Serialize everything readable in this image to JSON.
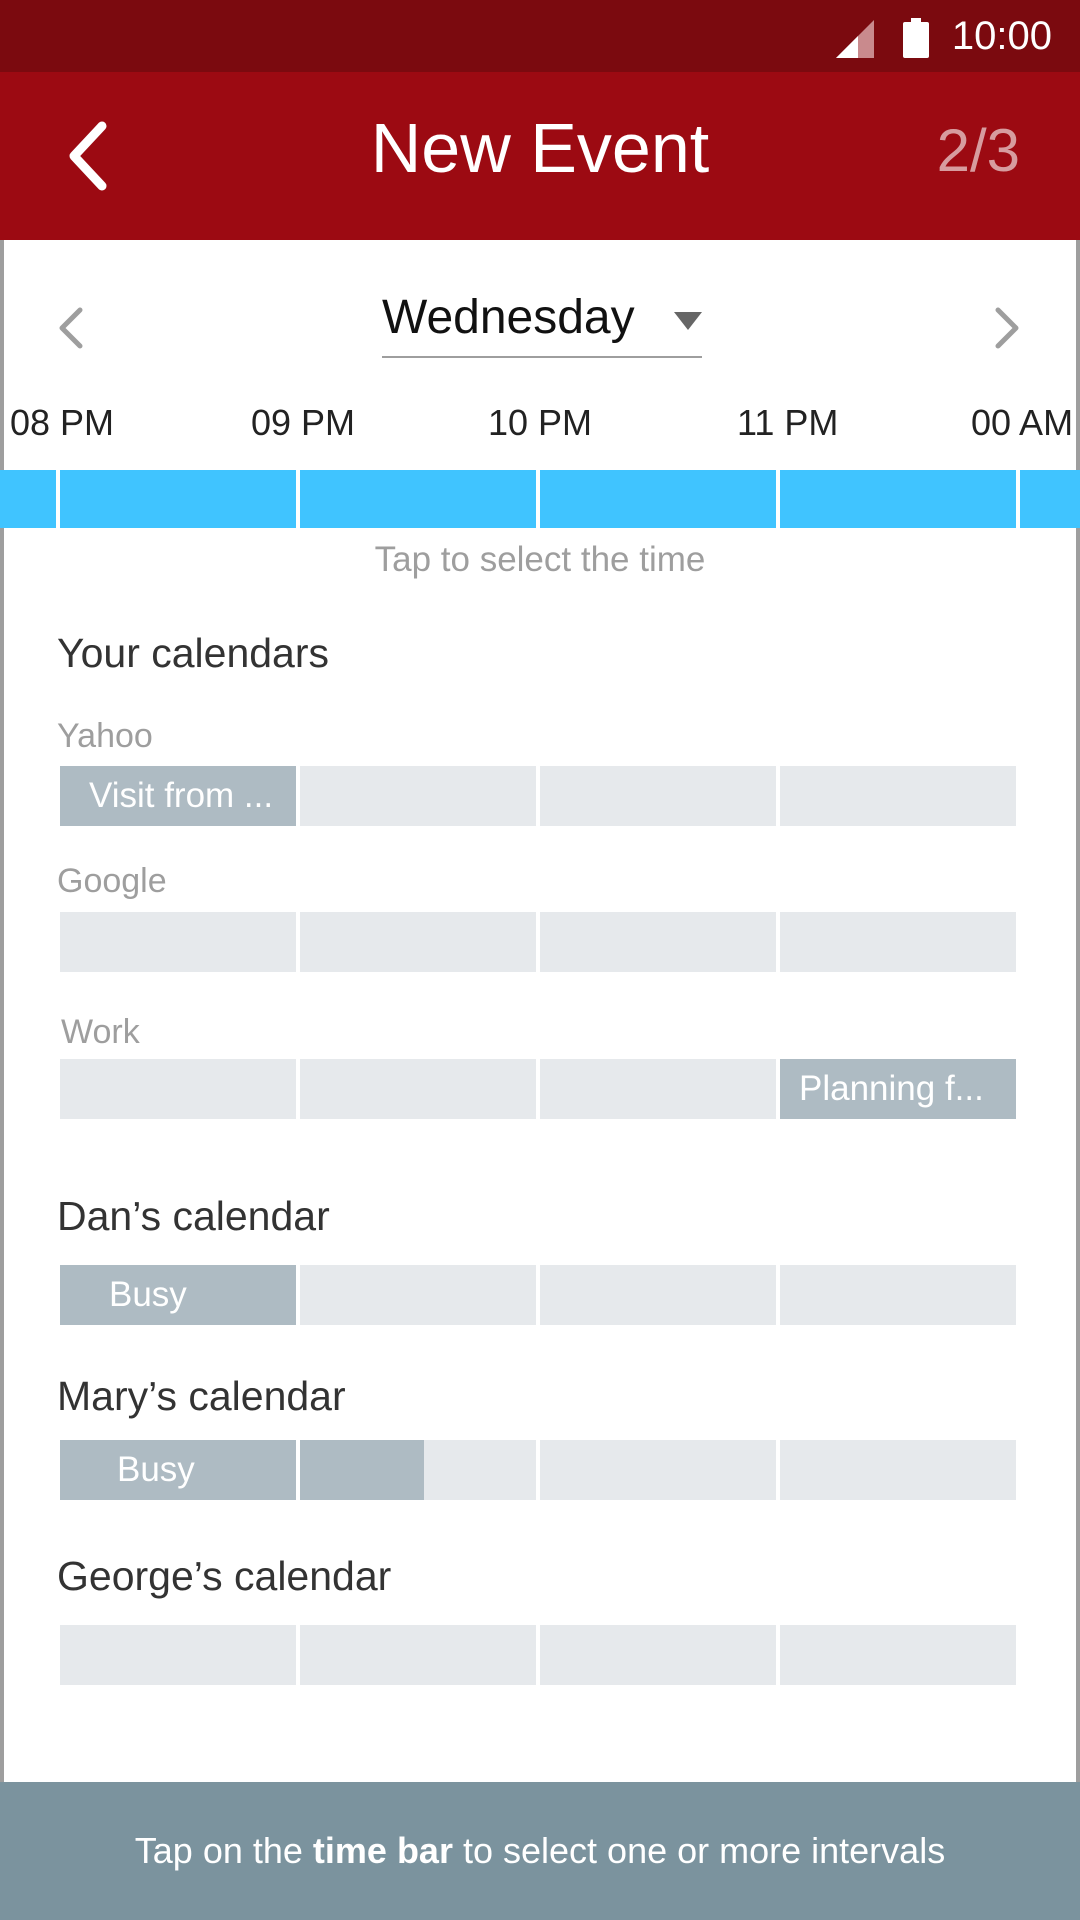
{
  "status": {
    "time": "10:00"
  },
  "appbar": {
    "title": "New Event",
    "step": "2/3"
  },
  "day_selector": {
    "selected_day": "Wednesday"
  },
  "timeline": {
    "hours": [
      "08 PM",
      "09 PM",
      "10 PM",
      "11 PM",
      "00 AM"
    ],
    "hint": "Tap to select the time"
  },
  "your_calendars": {
    "title": "Your calendars",
    "calendars": [
      {
        "label": "Yahoo",
        "event_text": "Visit from ..."
      },
      {
        "label": "Google"
      },
      {
        "label": "Work",
        "event_text": "Planning f..."
      }
    ]
  },
  "shared_calendars": [
    {
      "title": "Dan’s calendar",
      "busy_text": "Busy"
    },
    {
      "title": "Mary’s calendar",
      "busy_text": "Busy"
    },
    {
      "title": "George’s calendar"
    }
  ],
  "footer": {
    "text_before": "Tap on the ",
    "text_bold": "time bar",
    "text_after": " to select one or more intervals"
  },
  "colors": {
    "status_bar": "#7b0a0f",
    "app_bar": "#9c0a12",
    "time_bar": "#40c4ff",
    "free_slot": "#e6e9ec",
    "busy_slot": "#aebbc3",
    "footer": "#7b939e"
  }
}
